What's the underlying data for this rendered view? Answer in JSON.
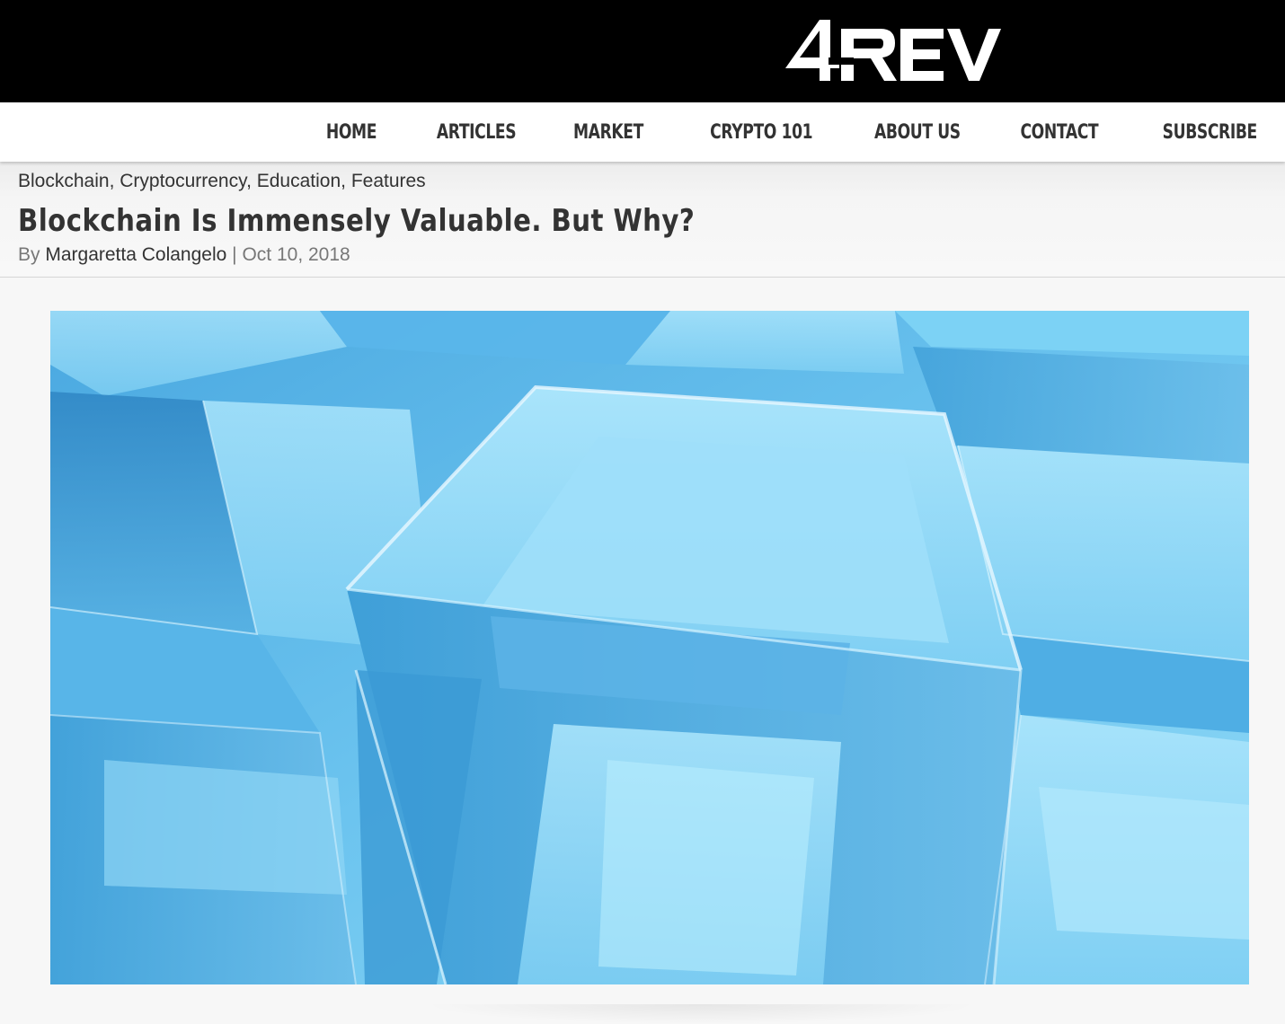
{
  "site": {
    "logo_text": "4REV",
    "background": "#000000"
  },
  "nav": {
    "items": [
      {
        "label": "HOME",
        "id": "home"
      },
      {
        "label": "ARTICLES",
        "id": "articles"
      },
      {
        "label": "MARKET",
        "id": "market"
      },
      {
        "label": "CRYPTO 101",
        "id": "crypto-101"
      },
      {
        "label": "ABOUT US",
        "id": "about-us"
      },
      {
        "label": "CONTACT",
        "id": "contact"
      },
      {
        "label": "SUBSCRIBE",
        "id": "subscribe"
      }
    ]
  },
  "post": {
    "categories": [
      "Blockchain",
      "Cryptocurrency",
      "Education",
      "Features"
    ],
    "category_separator": ", ",
    "title": "Blockchain Is Immensely Valuable. But Why?",
    "by_label": "By",
    "author": "Margaretta Colangelo",
    "separator": "|",
    "date": "Oct 10, 2018",
    "hero_image": "blue-glass-cubes-image"
  }
}
